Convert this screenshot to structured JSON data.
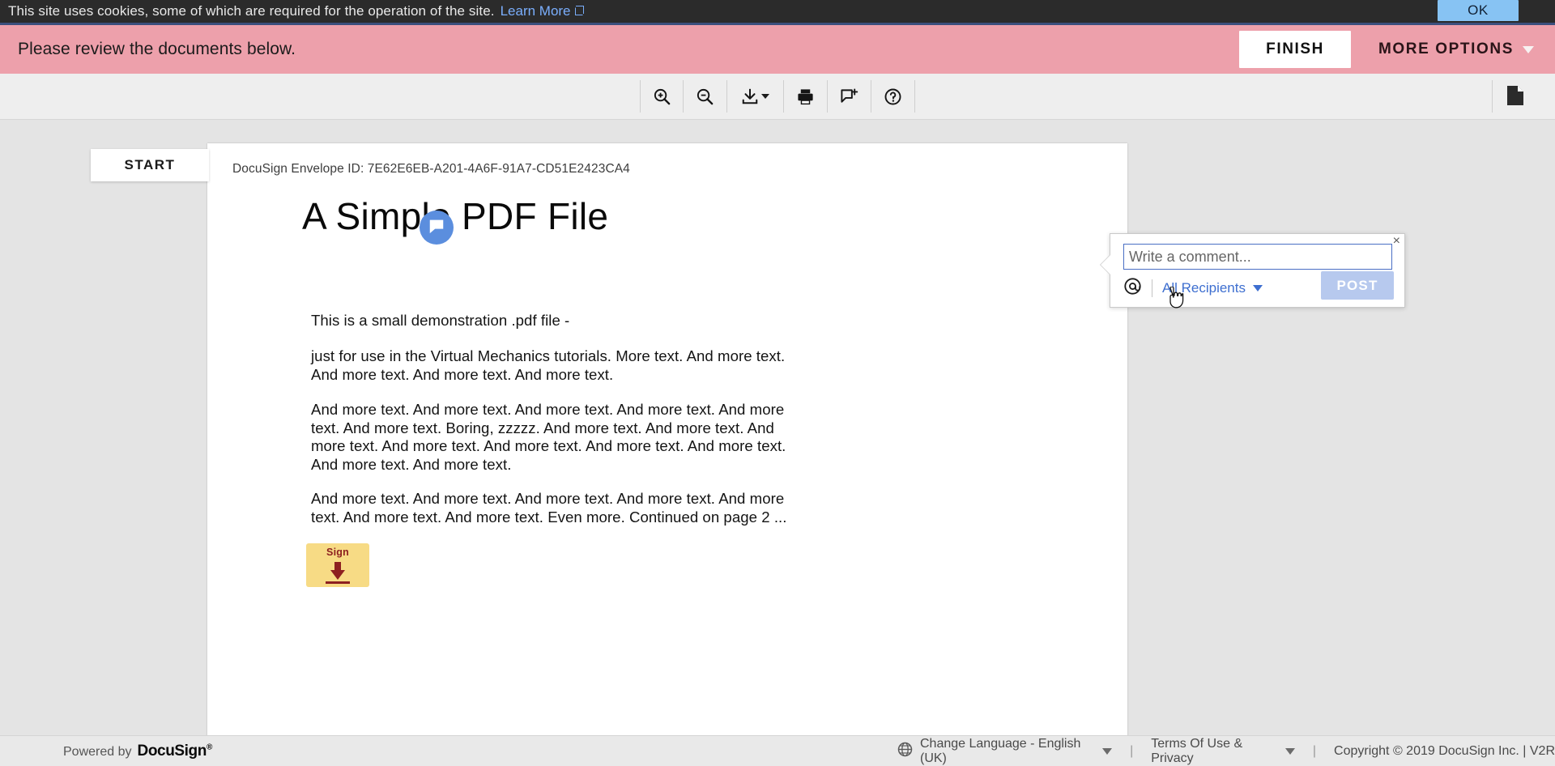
{
  "cookie_bar": {
    "message": "This site uses cookies, some of which are required for the operation of the site.",
    "learn_more": "Learn More",
    "ok_label": "OK",
    "background": "#2b2b2b",
    "link_color": "#7aaefc",
    "ok_background": "#87c3f3"
  },
  "review_banner": {
    "message": "Please review the documents below.",
    "finish_label": "FINISH",
    "more_options_label": "MORE OPTIONS",
    "background": "#eda0ab",
    "top_border": "#3b4f7d"
  },
  "toolbar": {
    "zoom_in": "zoom-in",
    "zoom_out": "zoom-out",
    "download": "download",
    "print": "print",
    "add_comment": "add-comment",
    "help": "help",
    "pages": "page-thumbnails"
  },
  "start_flag": {
    "label": "START"
  },
  "document": {
    "envelope_id": "DocuSign Envelope ID: 7E62E6EB-A201-4A6F-91A7-CD51E2423CA4",
    "title": "A Simple PDF File",
    "paragraphs": [
      "This is a small demonstration .pdf file -",
      "just for use in the Virtual Mechanics tutorials. More text. And more text. And more text. And more text. And more text.",
      "And more text. And more text. And more text. And more text. And more text. And more text. Boring, zzzzz. And more text. And more text. And more text. And more text. And more text. And more text. And more text. And more text. And more text.",
      "And more text. And more text. And more text. And more text. And more text. And more text. And more text. Even more. Continued on page 2 ..."
    ],
    "sign_tag_label": "Sign",
    "sign_tag_color": "#f7db85",
    "sign_tag_text_color": "#8d2020",
    "comment_marker": "comment-bubble",
    "comment_marker_color": "#5b8ede"
  },
  "comment_popup": {
    "placeholder": "Write a comment...",
    "value": "",
    "mention_icon": "at-mention-icon",
    "recipients_label": "All Recipients",
    "post_label": "POST",
    "close_label": "×",
    "accent_color": "#3e6fd0"
  },
  "footer": {
    "powered_by": "Powered by",
    "brand": "DocuSign",
    "brand_reg": "®",
    "language": "Change Language - English (UK)",
    "separator": "|",
    "terms": "Terms Of Use & Privacy",
    "copyright": "Copyright © 2019 DocuSign Inc. | V2R"
  }
}
